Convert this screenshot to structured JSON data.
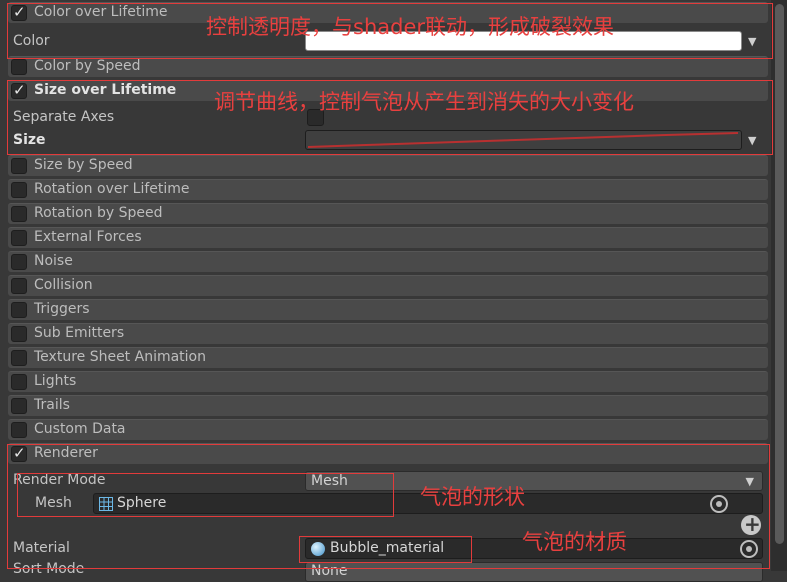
{
  "color_over_lifetime": {
    "label": "Color over Lifetime",
    "enabled": true,
    "color_label": "Color",
    "gradient_color": "#ffffff",
    "annotation": "控制透明度，与shader联动，形成破裂效果"
  },
  "color_by_speed": {
    "label": "Color by Speed",
    "enabled": false
  },
  "size_over_lifetime": {
    "label": "Size over Lifetime",
    "enabled": true,
    "separate_axes_label": "Separate Axes",
    "separate_axes_checked": false,
    "size_label": "Size",
    "curve_color": "#b83030",
    "annotation": "调节曲线，控制气泡从产生到消失的大小变化"
  },
  "modules": [
    {
      "label": "Size by Speed",
      "enabled": false
    },
    {
      "label": "Rotation over Lifetime",
      "enabled": false
    },
    {
      "label": "Rotation by Speed",
      "enabled": false
    },
    {
      "label": "External Forces",
      "enabled": false
    },
    {
      "label": "Noise",
      "enabled": false
    },
    {
      "label": "Collision",
      "enabled": false
    },
    {
      "label": "Triggers",
      "enabled": false
    },
    {
      "label": "Sub Emitters",
      "enabled": false
    },
    {
      "label": "Texture Sheet Animation",
      "enabled": false
    },
    {
      "label": "Lights",
      "enabled": false
    },
    {
      "label": "Trails",
      "enabled": false
    },
    {
      "label": "Custom Data",
      "enabled": false
    }
  ],
  "renderer": {
    "label": "Renderer",
    "enabled": true,
    "render_mode_label": "Render Mode",
    "render_mode_value": "Mesh",
    "mesh_label": "Mesh",
    "mesh_value": "Sphere",
    "mesh_annotation": "气泡的形状",
    "material_label": "Material",
    "material_value": "Bubble_material",
    "material_annotation": "气泡的材质",
    "sort_mode_label": "Sort Mode",
    "sort_mode_value": "None"
  },
  "colors": {
    "annotation": "#e8403f",
    "panel_bg": "#383838",
    "module_header": "#4a4a4a"
  }
}
